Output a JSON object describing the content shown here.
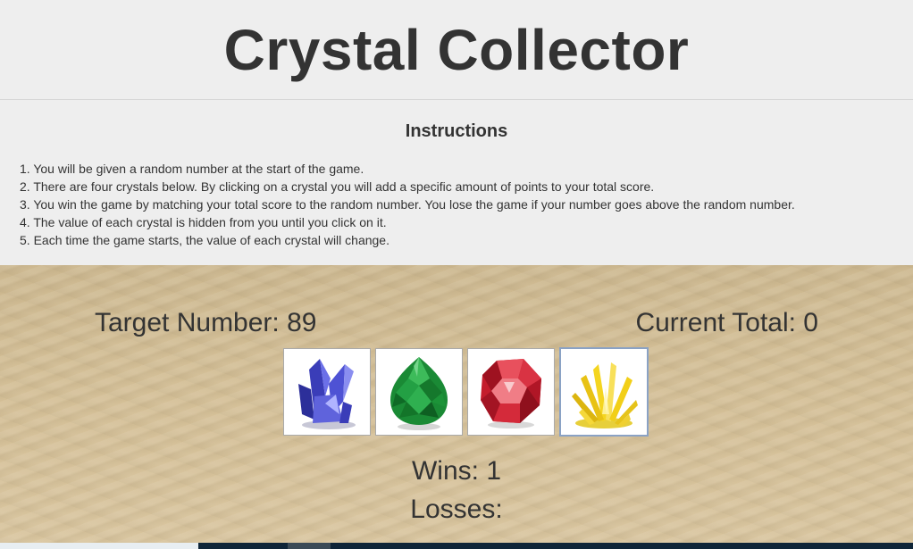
{
  "header": {
    "title": "Crystal Collector"
  },
  "instructions": {
    "heading": "Instructions",
    "items": [
      "1. You will be given a random number at the start of the game.",
      "2. There are four crystals below. By clicking on a crystal you will add a specific amount of points to your total score.",
      "3. You win the game by matching your total score to the random number. You lose the game if your number goes above the random number.",
      "4. The value of each crystal is hidden from you until you click on it.",
      "5. Each time the game starts, the value of each crystal will change."
    ]
  },
  "game": {
    "target_text": "Target Number: 89",
    "current_text": "Current Total: 0",
    "wins_text": "Wins: 1",
    "losses_text": "Losses:",
    "crystals": [
      {
        "name": "blue crystal",
        "color": "#4a4fd0"
      },
      {
        "name": "green crystal",
        "color": "#1f9a3a"
      },
      {
        "name": "red crystal",
        "color": "#d02030"
      },
      {
        "name": "yellow crystal",
        "color": "#f2d21a"
      }
    ]
  },
  "colors": {
    "sand": "#d2bd94",
    "text": "#333333",
    "selected_border": "#8aa2c5"
  }
}
